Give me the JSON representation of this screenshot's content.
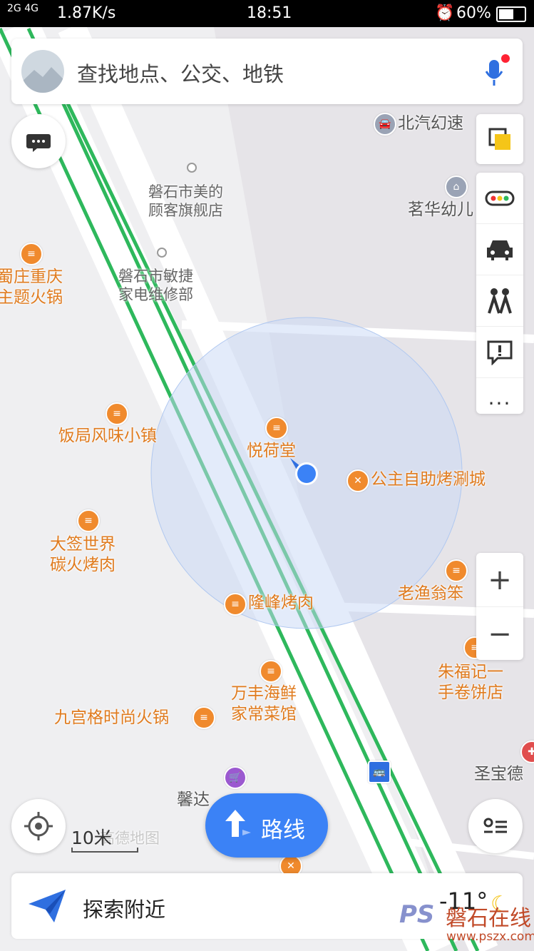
{
  "status_bar": {
    "signal": "2G 4G",
    "speed": "1.87K/s",
    "time": "18:51",
    "battery": "60%"
  },
  "search": {
    "placeholder": "查找地点、公交、地铁"
  },
  "map": {
    "labels": {
      "beiqi": "北汽幻速",
      "meidi": "磐石市美的\n顾客旗舰店",
      "minjie": "磐石市敏捷\n家电维修部",
      "minghua": "茗华幼儿",
      "shuzhuang": "蜀庄重庆\n主题火锅",
      "fanju": "饭局风味小镇",
      "yuehe": "悦荷堂",
      "gongzhu": "公主自助烤涮城",
      "daqian": "大签世界\n碳火烤肉",
      "laoyuweng": "老渔翁笨",
      "longfeng": "隆峰烤肉",
      "wanfeng": "万丰海鲜\n家常菜馆",
      "zhufuji": "朱福记一\n手卷饼店",
      "jiugongge": "九宫格时尚火锅",
      "shengbao": "圣宝德",
      "xinda": "馨达",
      "gaode": "高德地图"
    },
    "scale_label": "10米"
  },
  "controls": {
    "route_label": "路线",
    "zoom_in": "+",
    "zoom_out": "−"
  },
  "bottom": {
    "explore_label": "探索附近",
    "temperature": "-11°"
  },
  "watermark": {
    "logo": "PS",
    "brand": "磐石在线",
    "url": "www.pszx.com"
  },
  "colors": {
    "accent": "#3b82f6",
    "poi": "#f08a2d",
    "rail": "#2eb85c"
  }
}
